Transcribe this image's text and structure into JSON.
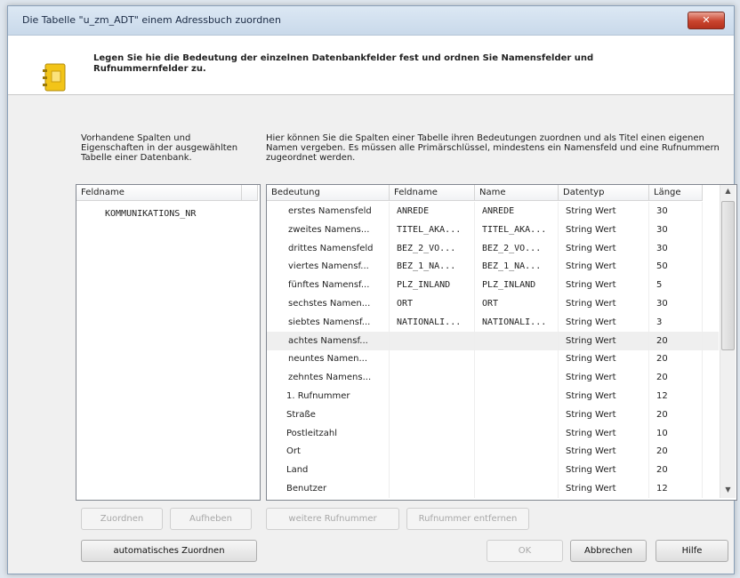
{
  "window": {
    "title": "Die Tabelle \"u_zm_ADT\" einem Adressbuch zuordnen",
    "close_glyph": "✕"
  },
  "header": {
    "instruction": "Legen Sie hie die Bedeutung der einzelnen Datenbankfelder fest und ordnen Sie Namensfelder und Rufnummernfelder zu."
  },
  "left": {
    "description": "Vorhandene Spalten und Eigenschaften in der ausgewählten Tabelle einer Datenbank.",
    "column_header": "Feldname",
    "items": [
      "KOMMUNIKATIONS_NR"
    ]
  },
  "right": {
    "description": "Hier können Sie die Spalten einer Tabelle ihren Bedeutungen zuordnen und als Titel einen eigenen Namen vergeben. Es müssen alle Primärschlüssel, mindestens ein Namensfeld und eine Rufnummern zugeordnet werden.",
    "columns": [
      "Bedeutung",
      "Feldname",
      "Name",
      "Datentyp",
      "Länge"
    ],
    "rows": [
      [
        "erstes Namensfeld",
        "ANREDE",
        "ANREDE",
        "String Wert",
        "30"
      ],
      [
        "zweites Namens...",
        "TITEL_AKA...",
        "TITEL_AKA...",
        "String Wert",
        "30"
      ],
      [
        "drittes Namensfeld",
        "BEZ_2_VO...",
        "BEZ_2_VO...",
        "String Wert",
        "30"
      ],
      [
        "viertes Namensf...",
        "BEZ_1_NA...",
        "BEZ_1_NA...",
        "String Wert",
        "50"
      ],
      [
        "fünftes Namensf...",
        "PLZ_INLAND",
        "PLZ_INLAND",
        "String Wert",
        "5"
      ],
      [
        "sechstes Namen...",
        "ORT",
        "ORT",
        "String Wert",
        "30"
      ],
      [
        "siebtes Namensf...",
        "NATIONALI...",
        "NATIONALI...",
        "String Wert",
        "3"
      ],
      [
        "achtes Namensf...",
        "",
        "",
        "String Wert",
        "20"
      ],
      [
        "neuntes Namen...",
        "",
        "",
        "String Wert",
        "20"
      ],
      [
        "zehntes Namens...",
        "",
        "",
        "String Wert",
        "20"
      ],
      [
        "1. Rufnummer",
        "",
        "",
        "String Wert",
        "12"
      ],
      [
        "Straße",
        "",
        "",
        "String Wert",
        "20"
      ],
      [
        "Postleitzahl",
        "",
        "",
        "String Wert",
        "10"
      ],
      [
        "Ort",
        "",
        "",
        "String Wert",
        "20"
      ],
      [
        "Land",
        "",
        "",
        "String Wert",
        "20"
      ],
      [
        "Benutzer",
        "",
        "",
        "String Wert",
        "12"
      ]
    ],
    "selected_row": 7
  },
  "buttons": {
    "zuordnen": "Zuordnen",
    "aufheben": "Aufheben",
    "weitere": "weitere Rufnummer",
    "entfernen": "Rufnummer entfernen",
    "auto": "automatisches Zuordnen",
    "ok": "OK",
    "abbrechen": "Abbrechen",
    "hilfe": "Hilfe"
  }
}
